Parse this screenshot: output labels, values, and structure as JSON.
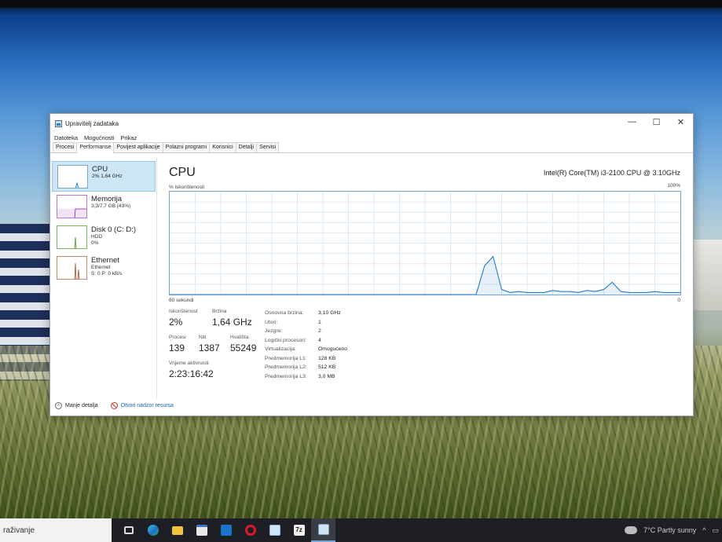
{
  "window": {
    "title": "Upravitelj zadataka",
    "controls": {
      "minimize": "—",
      "maximize": "☐",
      "close": "✕"
    }
  },
  "menu": [
    "Datoteka",
    "Mogućnosti",
    "Prikaz"
  ],
  "tabs": [
    "Procesi",
    "Performanse",
    "Povijest aplikacije",
    "Polazni programi",
    "Korisnici",
    "Detalji",
    "Servisi"
  ],
  "active_tab": "Performanse",
  "sidebar": {
    "items": [
      {
        "name": "CPU",
        "sub1": "2% 1,64 GHz",
        "sub2": "",
        "sub3": "",
        "selected": true,
        "color": "#1170c9"
      },
      {
        "name": "Memorija",
        "sub1": "3,3/7,7 GB (43%)",
        "sub2": "",
        "sub3": "",
        "selected": false,
        "color": "#8b1aa8"
      },
      {
        "name": "Disk 0 (C: D:)",
        "sub1": "HDD",
        "sub2": "0%",
        "sub3": "",
        "selected": false,
        "color": "#4a9a1f"
      },
      {
        "name": "Ethernet",
        "sub1": "Ethernet",
        "sub2": "S: 0 P: 0 kB/s",
        "sub3": "",
        "selected": false,
        "color": "#a0522d"
      }
    ]
  },
  "main": {
    "title": "CPU",
    "model": "Intel(R) Core(TM) i3-2100 CPU @ 3.10GHz",
    "graph_label": "% iskorištenosti",
    "graph_max": "100%",
    "graph_time": "60 sekundi",
    "graph_min": "0"
  },
  "stats": {
    "utilization_label": "Iskorištenost",
    "utilization": "2%",
    "speed_label": "Brzina",
    "speed": "1,64 GHz",
    "processes_label": "Procesi",
    "processes": "139",
    "threads_label": "Niti",
    "threads": "1387",
    "handles_label": "Hvatišta",
    "handles": "55249",
    "uptime_label": "Vrijeme aktivnosti",
    "uptime": "2:23:16:42"
  },
  "details": [
    {
      "k": "Osnovna brzina:",
      "v": "3,10 GHz"
    },
    {
      "k": "Utori:",
      "v": "1"
    },
    {
      "k": "Jezgre:",
      "v": "2"
    },
    {
      "k": "Logički procesori:",
      "v": "4"
    },
    {
      "k": "Virtualizacija:",
      "v": "Omogućeno"
    },
    {
      "k": "Predmemorija L1:",
      "v": "128 KB"
    },
    {
      "k": "Predmemorija L2:",
      "v": "512 KB"
    },
    {
      "k": "Predmemorija L3:",
      "v": "3,0 MB"
    }
  ],
  "footer": {
    "fewer_details": "Manje detalja",
    "open_resmon": "Otvori nadzor resursa"
  },
  "taskbar": {
    "search": "raživanje",
    "weather": "7°C  Partly sunny",
    "icons": [
      "task-view",
      "edge",
      "file-explorer",
      "store",
      "outlook",
      "opera",
      "notepad",
      "7zip",
      "task-manager"
    ]
  },
  "chart_data": {
    "type": "area",
    "title": "",
    "xlabel": "60 sekundi",
    "ylabel": "% iskorištenosti",
    "ylim": [
      0,
      100
    ],
    "x": [
      0,
      1,
      2,
      3,
      4,
      5,
      6,
      7,
      8,
      9,
      10,
      11,
      12,
      13,
      14,
      15,
      16,
      17,
      18,
      19,
      20,
      21,
      22,
      23,
      24,
      25,
      26,
      27,
      28,
      29,
      30,
      31,
      32,
      33,
      34,
      35,
      36,
      37,
      38,
      39,
      40,
      41,
      42,
      43,
      44,
      45,
      46,
      47,
      48,
      49,
      50,
      51,
      52,
      53,
      54,
      55,
      56,
      57,
      58,
      59,
      60
    ],
    "values": [
      0,
      0,
      0,
      0,
      0,
      0,
      0,
      0,
      0,
      0,
      0,
      0,
      0,
      0,
      0,
      0,
      0,
      0,
      0,
      0,
      0,
      0,
      0,
      0,
      0,
      0,
      0,
      0,
      0,
      0,
      0,
      0,
      0,
      0,
      0,
      0,
      0,
      28,
      37,
      5,
      2,
      3,
      2,
      2,
      2,
      4,
      3,
      3,
      2,
      4,
      3,
      5,
      12,
      3,
      2,
      2,
      2,
      3,
      2,
      2,
      2
    ]
  }
}
